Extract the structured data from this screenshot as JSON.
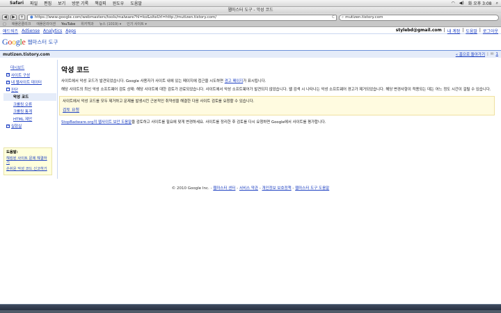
{
  "menubar": {
    "apple": "",
    "items": [
      "Safari",
      "파일",
      "편집",
      "보기",
      "방문 기록",
      "책갈피",
      "윈도우",
      "도움말"
    ],
    "clock": "화 오후 3:08",
    "colors": {
      "bg": "#e6e6e6"
    }
  },
  "window": {
    "title": "웹마스터 도구 - 악성 코드",
    "back": "◀",
    "forward": "▶",
    "add": "+",
    "url": "https://www.google.com/webmasters/tools/malware?hl=ko&siteUrl=http://mutizen.tistory.com/",
    "reload": "C",
    "search": "mutizen.tistory.com",
    "bookmarks": [
      "□",
      "애플온클리크",
      "애플온라이센",
      "YouTube",
      "위키백과",
      "뉴스 (1019) ▾",
      "인기 사이트 ▾"
    ]
  },
  "gbar": {
    "items": [
      "애드워즈",
      "AdSense",
      "Analytics",
      "Apps"
    ],
    "email": "stylebd@gmail.com",
    "sep": "|",
    "account": "내 계정",
    "help": "도움말",
    "logout": "로그아웃"
  },
  "header": {
    "logo": [
      "G",
      "o",
      "o",
      "g",
      "l",
      "e"
    ],
    "product": "웹마스터 도구"
  },
  "sitebar": {
    "site": "mutizen.tistory.com",
    "back_home": "« 홈으로 돌아가기",
    "sep": "|",
    "mail_icon": "✉",
    "count": "1"
  },
  "sidebar": {
    "items": [
      {
        "label": "대시보드",
        "expander": ""
      },
      {
        "label": "사이트 구성",
        "expander": "+"
      },
      {
        "label": "내 웹사이트 데이터",
        "expander": "+"
      },
      {
        "label": "진단",
        "expander": "−"
      },
      {
        "label": "악성 코드",
        "expander": ""
      },
      {
        "label": "크롤링 오류",
        "expander": ""
      },
      {
        "label": "크롤링 통계",
        "expander": ""
      },
      {
        "label": "HTML 제안",
        "expander": ""
      },
      {
        "label": "실험실",
        "expander": "+"
      }
    ],
    "help": {
      "title": "도움말:",
      "links": [
        "해킹된 사이트 문제 해결하기",
        "손쉬운 악성 코드 신고하기"
      ]
    }
  },
  "main": {
    "title": "악성 코드",
    "p1_before": "사이트에서 악성 코드가 발견되었습니다. Google 사용자가 사이트 내에 있는 페이지에 접근을 시도하면 ",
    "p1_link": "경고 페이지",
    "p1_after": "가 표시됩니다.",
    "p2": "해당 사이트의 최신 악성 소프트웨어 검토 상태: 해당 사이트에 대한 검토가 완료되었습니다. 사이트에서 악성 소프트웨어가 발견되지 않았습니다. 웹 검색 시 나타나는 악성 소프트웨어 경고가 제거되었습니다. 해당 변경사항이 적용되는 데는 어느 정도 시간이 걸릴 수 있습니다.",
    "notice_text": "사이트에서 악성 코드를 모두 제거하고 문제를 발생시킨 근본적인 취약성을 해결한 다음 사이트 검토를 요청할 수 있습니다.",
    "notice_link": "검토 요청",
    "p3_link": "StopBadware.org의 웹사이트 보안 도움말",
    "p3_after": "을 검토하고 사이트를 필요에 맞게 변경하세요. 사이트를 정리한 후 검토를 다시 요청하면 Google에서 사이트를 평가합니다."
  },
  "footer": {
    "copyright": "© 2010 Google Inc.",
    "sep": " - ",
    "links": [
      "웹마스터 센터",
      "서비스 약관",
      "개인정보 보호정책",
      "웹마스터 도구 도움말"
    ]
  }
}
